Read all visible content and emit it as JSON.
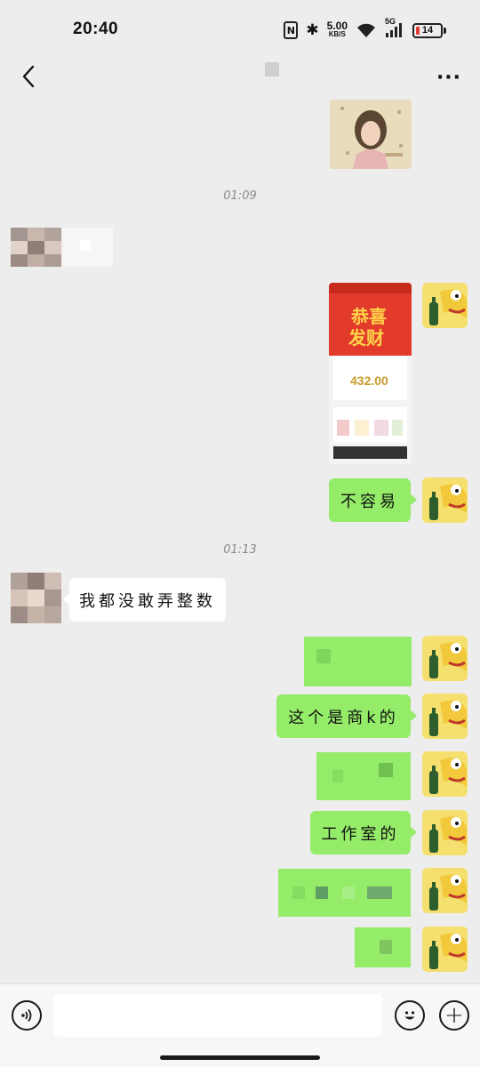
{
  "status_bar": {
    "time": "20:40",
    "nfc_label": "N",
    "bluetooth_glyph": "✱",
    "net_speed_value": "5.00",
    "net_speed_unit": "KB/S",
    "network_type": "5G",
    "battery_level": "14",
    "battery_fraction": 0.14,
    "battery_low_color": "#e53935"
  },
  "header": {
    "back_icon": "chevron-left-icon",
    "more_icon": "more-dots-icon",
    "more_glyph": "···"
  },
  "chat": {
    "timestamps": [
      "01:09",
      "01:13"
    ],
    "messages": [
      {
        "sender": "me",
        "type": "image",
        "content": "sticker-image"
      },
      {
        "sender": "other",
        "type": "text",
        "content": ""
      },
      {
        "sender": "me",
        "type": "image",
        "content": "red-packet-screenshot"
      },
      {
        "sender": "me",
        "type": "text",
        "content": "不容易"
      },
      {
        "sender": "other",
        "type": "text",
        "content": "我都没敢弄整数"
      },
      {
        "sender": "me",
        "type": "text",
        "content": ""
      },
      {
        "sender": "me",
        "type": "text",
        "content": "这个是商k的"
      },
      {
        "sender": "me",
        "type": "text",
        "content": ""
      },
      {
        "sender": "me",
        "type": "text",
        "content": "工作室的"
      },
      {
        "sender": "me",
        "type": "text",
        "content": ""
      },
      {
        "sender": "me",
        "type": "text",
        "content": ""
      }
    ],
    "red_packet": {
      "banner_line1": "恭喜",
      "banner_line2": "发财",
      "amount": "432.00"
    },
    "bubble_color_me": "#95ec69",
    "bubble_color_other": "#ffffff"
  },
  "input_bar": {
    "placeholder": "",
    "voice_icon": "voice-icon",
    "emoji_icon": "emoji-icon",
    "plus_icon": "plus-icon",
    "plus_glyph": "+"
  }
}
